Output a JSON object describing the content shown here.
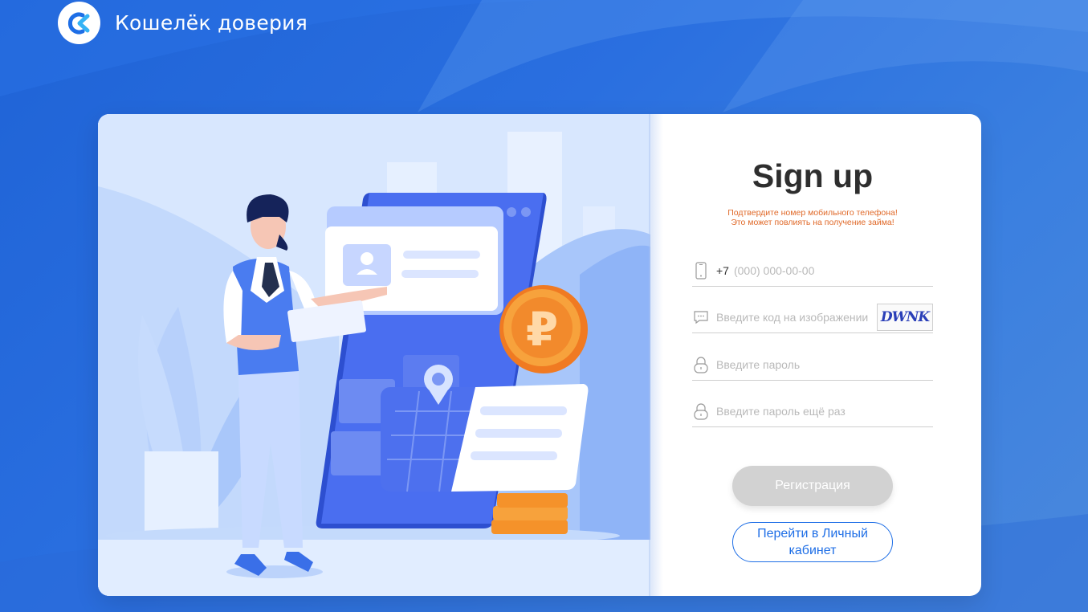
{
  "brand": {
    "name": "Кошелёк доверия",
    "colors": {
      "primary": "#1e6ee6",
      "accent": "#1f63d6",
      "notice": "#e06a2a"
    }
  },
  "signup": {
    "title": "Sign up",
    "notice_line1": "Подтвердите номер мобильного телефона!",
    "notice_line2": "Это может повлиять на получение займа!",
    "phone": {
      "prefix": "+7",
      "placeholder": "(000) 000-00-00",
      "icon": "phone-icon"
    },
    "captcha": {
      "placeholder": "Введите код на изображении",
      "icon": "message-icon",
      "image_text": "DWNK"
    },
    "password": {
      "placeholder": "Введите пароль",
      "icon": "lock-icon"
    },
    "password_repeat": {
      "placeholder": "Введите пароль ещё раз",
      "icon": "lock-icon"
    },
    "register_button": "Регистрация",
    "cabinet_button": "Перейти в Личный кабинет"
  }
}
